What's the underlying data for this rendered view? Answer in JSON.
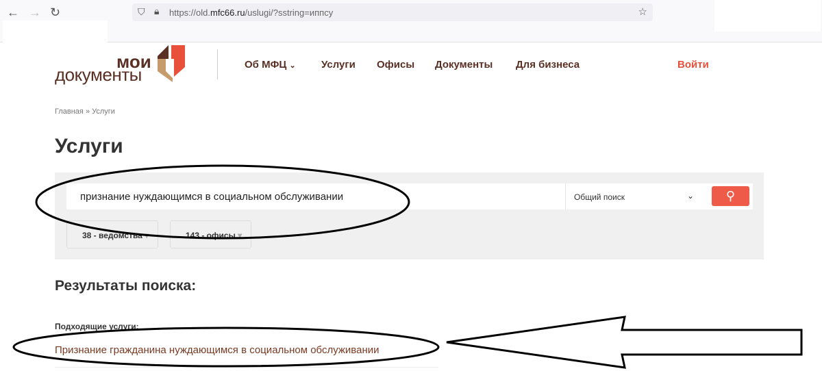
{
  "browser": {
    "url_prefix": "https://old.",
    "url_domain": "mfc66.ru",
    "url_path": "/uslugi/?sstring=иппсу"
  },
  "logo": {
    "line1": "мои",
    "line2": "документы"
  },
  "menu": [
    {
      "label": "Об МФЦ"
    },
    {
      "label": "Услуги"
    },
    {
      "label": "Офисы"
    },
    {
      "label": "Документы"
    },
    {
      "label": "Для бизнеса"
    }
  ],
  "login": "Войти",
  "breadcrumb": {
    "home": "Главная",
    "sep": "»",
    "current": "Услуги"
  },
  "title": "Услуги",
  "search": {
    "value": "признание нуждающимся в социальном обслуживании",
    "mode": "Общий поиск"
  },
  "filters": {
    "departments": "38 - ведомства",
    "offices": "143 - офисы"
  },
  "results": {
    "heading": "Результаты поиска:",
    "subheading": "Подходящие услуги:",
    "items": [
      "Признание гражданина нуждающимся в социальном обслуживании"
    ]
  }
}
